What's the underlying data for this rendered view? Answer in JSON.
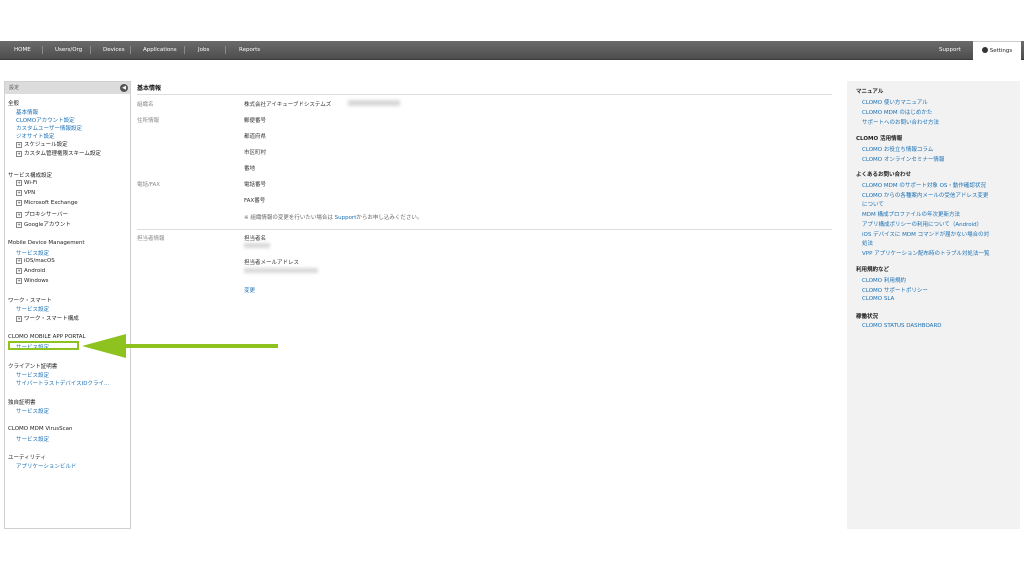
{
  "nav": {
    "items": [
      "HOME",
      "Users/Org",
      "Devices",
      "Applications",
      "Jobs",
      "Reports"
    ],
    "support": "Support",
    "settings": "Settings"
  },
  "sidebar": {
    "header": "設定",
    "groups": {
      "general": "全般",
      "general_items": [
        "基本情報",
        "CLOMOアカウント設定",
        "カスタムユーザー情報設定",
        "ジオサイト設定",
        "スケジュール設定",
        "カスタム管理権限スキーム設定"
      ],
      "service": "サービス構成設定",
      "service_items": [
        "Wi-Fi",
        "VPN",
        "Microsoft Exchange",
        "プロキシサーバー",
        "Googleアカウント"
      ],
      "mdm": "Mobile Device Management",
      "mdm_items": [
        "サービス設定",
        "iOS/macOS",
        "Android",
        "Windows"
      ],
      "work": "ワーク・スマート",
      "work_items": [
        "サービス設定",
        "ワーク・スマート構成"
      ],
      "portal": "CLOMO MOBILE APP PORTAL",
      "portal_items": [
        "サービス設定"
      ],
      "client": "クライアント証明書",
      "client_items": [
        "サービス設定",
        "サイバートラストデバイスIDクライ..."
      ],
      "own": "独自証明書",
      "own_items": [
        "サービス設定"
      ],
      "virus": "CLOMO MDM VirusScan",
      "virus_items": [
        "サービス設定"
      ],
      "util": "ユーティリティ",
      "util_items": [
        "アプリケーションビルド"
      ]
    }
  },
  "main": {
    "title": "基本情報",
    "org_label": "組織名",
    "org_value": "株式会社アイキューブドシステムズ",
    "addr_label": "住所情報",
    "addr_fields": [
      "郵便番号",
      "都道府県",
      "市区町村",
      "番地"
    ],
    "tel_label": "電話/FAX",
    "tel_fields": [
      "電話番号",
      "FAX番号"
    ],
    "note_pre": "※ 組織情報の変更を行いたい場合は",
    "note_link": "Support",
    "note_post": "からお申し込みください。",
    "contact_label": "担当者情報",
    "contact_name": "担当者名",
    "contact_mail": "担当者メールアドレス",
    "change": "変更"
  },
  "right": {
    "manual": "マニュアル",
    "manual_items": [
      "CLOMO 使い方マニュアル",
      "CLOMO MDM のはじめかた",
      "サポートへのお問い合わせ方法"
    ],
    "usage": "CLOMO 活用情報",
    "usage_items": [
      "CLOMO お役立ち情報コラム",
      "CLOMO オンラインセミナー情報"
    ],
    "faq": "よくあるお問い合わせ",
    "faq_items": [
      "CLOMO MDM のサポート対象 OS・動作確認状況",
      "CLOMO からの各種案内メールの受信アドレス変更",
      "について",
      "MDM 構成プロファイルの年次更新方法",
      "アプリ構成ポリシーの利用について（Android）",
      "iOS デバイスに MDM コマンドが届かない場合の対",
      "処法",
      "VPP アプリケーション配布時のトラブル対処法一覧"
    ],
    "terms": "利用規約など",
    "terms_items": [
      "CLOMO 利用規約",
      "CLOMO サポートポリシー",
      "CLOMO SLA"
    ],
    "status": "稼働状況",
    "status_items": [
      "CLOMO STATUS DASHBOARD"
    ]
  },
  "colors": {
    "accent_green": "#8dc21f",
    "link_blue": "#1a6fb3",
    "nav_bg": "#555555"
  }
}
